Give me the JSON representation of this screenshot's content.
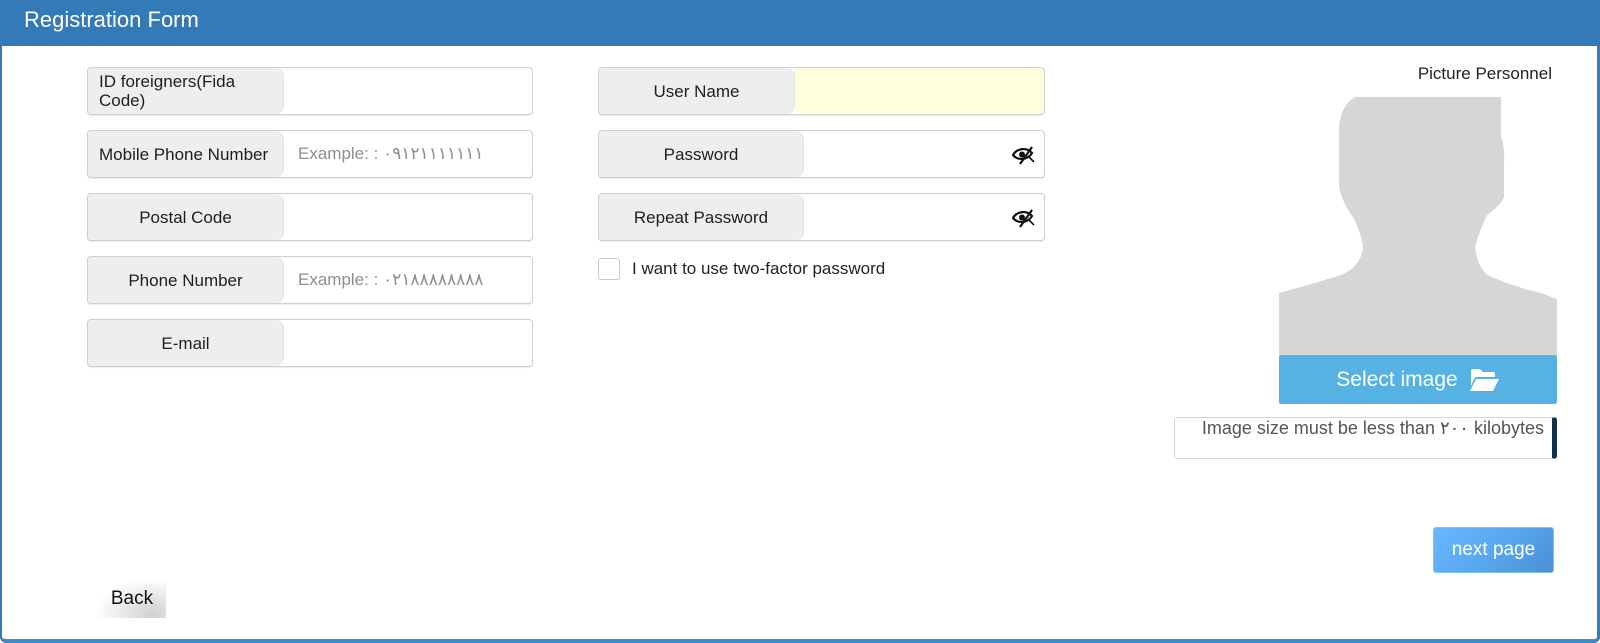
{
  "header": {
    "title": "Registration Form"
  },
  "left_fields": [
    {
      "label": "ID foreigners(Fida Code)",
      "value": "",
      "placeholder": ""
    },
    {
      "label": "Mobile Phone Number",
      "value": "",
      "placeholder": "Example: : ۰۹۱۲۱۱۱۱۱۱۱"
    },
    {
      "label": "Postal Code",
      "value": "",
      "placeholder": ""
    },
    {
      "label": "Phone Number",
      "value": "",
      "placeholder": "Example: : ۰۲۱۸۸۸۸۸۸۸۸"
    },
    {
      "label": "E-mail",
      "value": "",
      "placeholder": ""
    }
  ],
  "right_fields": {
    "username": {
      "label": "User Name",
      "value": "",
      "placeholder": ""
    },
    "password": {
      "label": "Password",
      "value": "",
      "placeholder": "",
      "toggle_icon": "eye-slash-icon"
    },
    "repeat_password": {
      "label": "Repeat Password",
      "value": "",
      "placeholder": "",
      "toggle_icon": "eye-slash-icon"
    }
  },
  "two_factor": {
    "label": "I want to use two-factor password",
    "checked": false
  },
  "picture": {
    "title": "Picture Personnel",
    "placeholder_icon": "person-silhouette-icon",
    "select_label": "Select image",
    "select_icon": "folder-open-icon",
    "size_note": "Image size must be less than ۲۰۰ kilobytes"
  },
  "actions": {
    "next_label": "next page",
    "back_label": "Back"
  },
  "colors": {
    "header_bg": "#337ab7",
    "select_button": "#55b2e2",
    "next_button": "#5aaaf2",
    "username_bg": "#ffffdb",
    "label_bg": "#eeeeee"
  }
}
